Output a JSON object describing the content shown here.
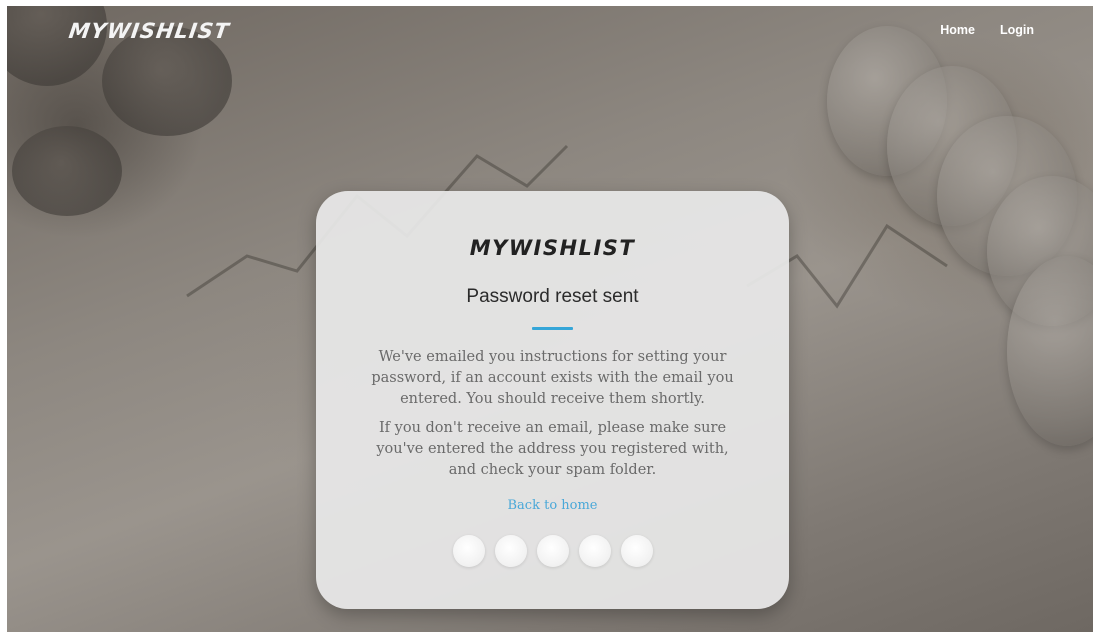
{
  "header": {
    "brand": "MYWISHLIST",
    "nav": [
      {
        "label": "Home"
      },
      {
        "label": "Login"
      }
    ]
  },
  "card": {
    "brand": "MYWISHLIST",
    "title": "Password reset sent",
    "message_1": "We've emailed you instructions for setting your password, if an account exists with the email you entered. You should receive them shortly.",
    "message_2": "If you don't receive an email, please make sure you've entered the address you registered with, and check your spam folder.",
    "back_link": "Back to home",
    "dot_count": 5
  },
  "colors": {
    "accent": "#35a6d8",
    "link": "#4aa8d8"
  }
}
